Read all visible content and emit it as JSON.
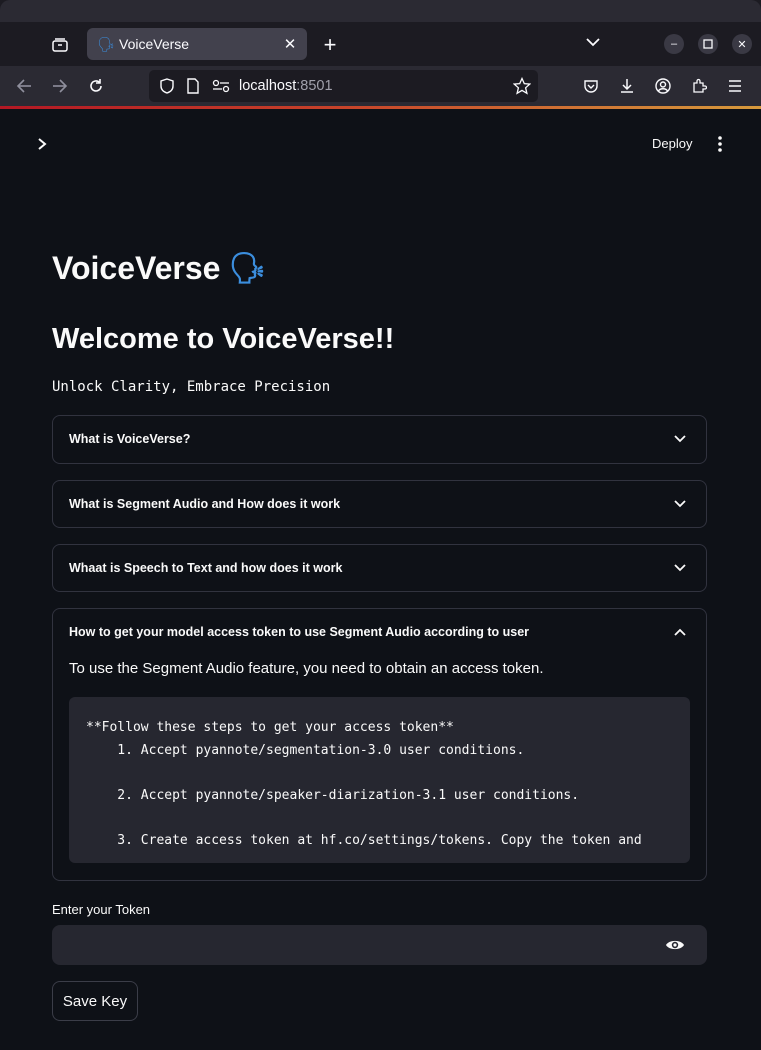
{
  "browser": {
    "tab_title": "VoiceVerse",
    "tab_favicon": "speaking-head-icon",
    "url_host": "localhost",
    "url_port": ":8501"
  },
  "header": {
    "deploy_label": "Deploy"
  },
  "main": {
    "title": "VoiceVerse",
    "title_emoji": "🗣",
    "subtitle": "Welcome to VoiceVerse!!",
    "tagline": "Unlock Clarity, Embrace Precision",
    "expanders": [
      {
        "label": "What is VoiceVerse?",
        "expanded": false
      },
      {
        "label": "What is Segment Audio and How does it work",
        "expanded": false
      },
      {
        "label": "Whaat is Speech to Text and how does it work",
        "expanded": false
      },
      {
        "label": "How to get your model access token to use Segment Audio according to user",
        "expanded": true
      }
    ],
    "expanded_intro": "To use the Segment Audio feature, you need to obtain an access token.",
    "code_lines": [
      "**Follow these steps to get your access token**",
      "    1. Accept pyannote/segmentation-3.0 user conditions.",
      "",
      "    2. Accept pyannote/speaker-diarization-3.1 user conditions.",
      "",
      "    3. Create access token at hf.co/settings/tokens. Copy the token and"
    ],
    "token_label": "Enter your Token",
    "token_value": "",
    "save_label": "Save Key"
  },
  "colors": {
    "background": "#0e1117",
    "input_bg": "#262730",
    "border": "#31333f"
  }
}
